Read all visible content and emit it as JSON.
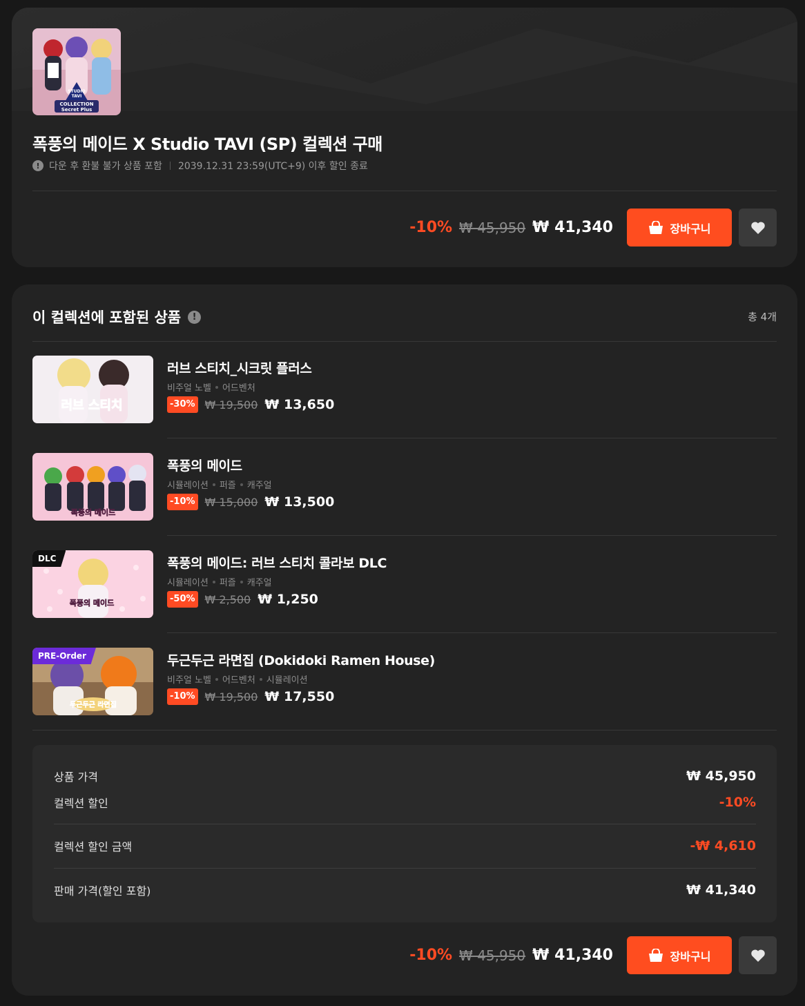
{
  "collection": {
    "title": "폭풍의 메이드 X Studio TAVI (SP) 컬렉션 구매",
    "refund_note": "다운 후 환불 불가 상품 포함",
    "sale_end": "2039.12.31 23:59(UTC+9) 이후 할인 종료",
    "cover_text": [
      "STUDIO",
      "TAVI",
      "COLLECTION",
      "Secret Plus"
    ]
  },
  "purchase": {
    "discount": "-10%",
    "original_price": "₩ 45,950",
    "final_price": "₩ 41,340",
    "cart_label": "장바구니"
  },
  "items_section": {
    "heading": "이 컬렉션에 포함된 상품",
    "total": "총 4개"
  },
  "items": [
    {
      "title": "러브 스티치_시크릿 플러스",
      "genres": [
        "비주얼 노벨",
        "어드벤처"
      ],
      "discount": "-30%",
      "original_price": "₩ 19,500",
      "final_price": "₩ 13,650",
      "thumb_text": "러브 스티치",
      "tag": ""
    },
    {
      "title": "폭풍의 메이드",
      "genres": [
        "시뮬레이션",
        "퍼즐",
        "캐주얼"
      ],
      "discount": "-10%",
      "original_price": "₩ 15,000",
      "final_price": "₩ 13,500",
      "thumb_text": "폭풍의 메이드",
      "tag": ""
    },
    {
      "title": "폭풍의 메이드: 러브 스티치 콜라보 DLC",
      "genres": [
        "시뮬레이션",
        "퍼즐",
        "캐주얼"
      ],
      "discount": "-50%",
      "original_price": "₩ 2,500",
      "final_price": "₩ 1,250",
      "thumb_text": "폭풍의 메이드",
      "tag": "DLC"
    },
    {
      "title": "두근두근 라면집 (Dokidoki Ramen House)",
      "genres": [
        "비주얼 노벨",
        "어드벤처",
        "시뮬레이션"
      ],
      "discount": "-10%",
      "original_price": "₩ 19,500",
      "final_price": "₩ 17,550",
      "thumb_text": "두근두근 라면집",
      "tag": "PRE-Order"
    }
  ],
  "summary": {
    "product_price_label": "상품 가격",
    "product_price": "₩ 45,950",
    "collection_discount_label": "컬렉션 할인",
    "collection_discount": "-10%",
    "discount_amount_label": "컬렉션 할인 금액",
    "discount_amount": "-₩ 4,610",
    "sale_price_label": "판매 가격(할인 포함)",
    "sale_price": "₩ 41,340"
  },
  "colors": {
    "accent": "#ff4d1f",
    "background": "#181818",
    "card": "#232323"
  }
}
